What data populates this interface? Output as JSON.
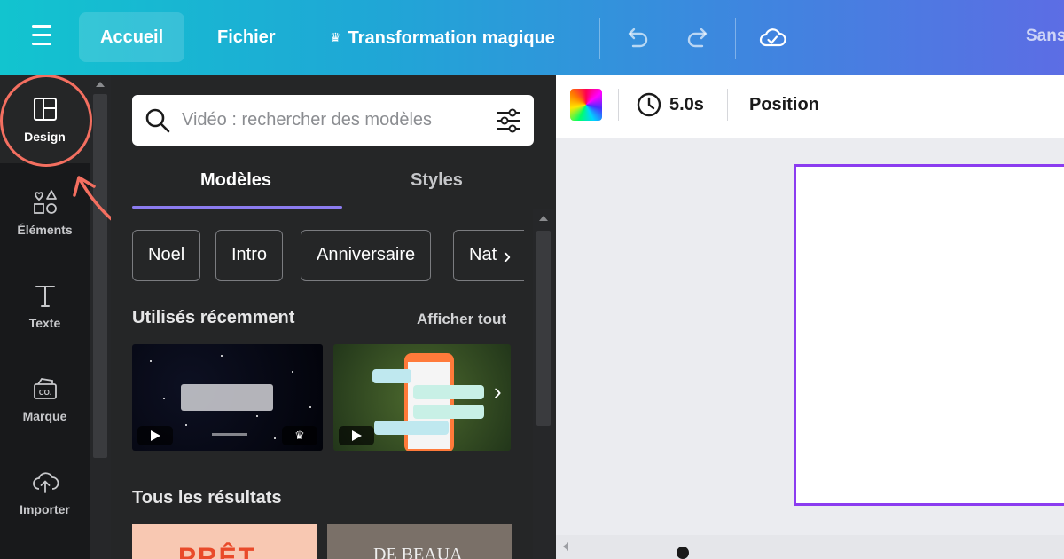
{
  "header": {
    "menu_icon": "hamburger-icon",
    "home": "Accueil",
    "file": "Fichier",
    "magic": "Transformation magique",
    "undo_icon": "undo-icon",
    "redo_icon": "redo-icon",
    "cloud_icon": "cloud-check-icon",
    "doc_title": "Sans"
  },
  "rail": {
    "items": [
      {
        "label": "Design",
        "icon": "layout-icon"
      },
      {
        "label": "Éléments",
        "icon": "shapes-icon"
      },
      {
        "label": "Texte",
        "icon": "text-icon"
      },
      {
        "label": "Marque",
        "icon": "brand-icon"
      },
      {
        "label": "Importer",
        "icon": "upload-cloud-icon"
      }
    ]
  },
  "panel": {
    "search_placeholder": "Vidéo : rechercher des modèles",
    "tabs": [
      "Modèles",
      "Styles"
    ],
    "chips": [
      "Noel",
      "Intro",
      "Anniversaire",
      "Nat"
    ],
    "recent_title": "Utilisés récemment",
    "see_all": "Afficher tout",
    "all_results_title": "Tous les résultats",
    "result_texts": [
      "PRÊT",
      "DE BEAUA"
    ]
  },
  "editor": {
    "duration": "5.0s",
    "position": "Position"
  },
  "colors": {
    "accent_purple": "#8c7cf0",
    "canvas_border": "#8b3cf0",
    "highlight": "#f46f60"
  }
}
